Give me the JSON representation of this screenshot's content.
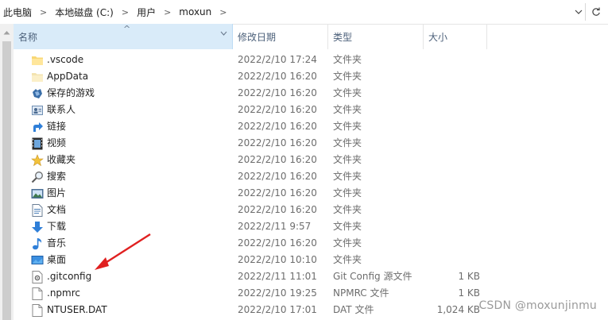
{
  "address": {
    "crumbs": [
      {
        "label": "此电脑"
      },
      {
        "label": "本地磁盘 (C:)"
      },
      {
        "label": "用户"
      },
      {
        "label": "moxun"
      }
    ],
    "icons": {
      "dropdown": "chevron-down-icon",
      "refresh": "refresh-icon",
      "separator": "chevron-right-icon"
    }
  },
  "columns": {
    "name": "名称",
    "date": "修改日期",
    "type": "类型",
    "size": "大小"
  },
  "files": [
    {
      "name": ".vscode",
      "date": "2022/2/10 17:24",
      "type": "文件夹",
      "size": "",
      "icon": "folder-icon"
    },
    {
      "name": "AppData",
      "date": "2022/2/10 16:20",
      "type": "文件夹",
      "size": "",
      "icon": "folder-light-icon"
    },
    {
      "name": "保存的游戏",
      "date": "2022/2/10 16:20",
      "type": "文件夹",
      "size": "",
      "icon": "saved-games-icon"
    },
    {
      "name": "联系人",
      "date": "2022/2/10 16:20",
      "type": "文件夹",
      "size": "",
      "icon": "contacts-icon"
    },
    {
      "name": "链接",
      "date": "2022/2/10 16:20",
      "type": "文件夹",
      "size": "",
      "icon": "links-icon"
    },
    {
      "name": "视频",
      "date": "2022/2/10 16:20",
      "type": "文件夹",
      "size": "",
      "icon": "videos-icon"
    },
    {
      "name": "收藏夹",
      "date": "2022/2/10 16:20",
      "type": "文件夹",
      "size": "",
      "icon": "favorites-star-icon"
    },
    {
      "name": "搜索",
      "date": "2022/2/10 16:20",
      "type": "文件夹",
      "size": "",
      "icon": "search-icon"
    },
    {
      "name": "图片",
      "date": "2022/2/10 16:20",
      "type": "文件夹",
      "size": "",
      "icon": "pictures-icon"
    },
    {
      "name": "文档",
      "date": "2022/2/10 16:20",
      "type": "文件夹",
      "size": "",
      "icon": "documents-icon"
    },
    {
      "name": "下载",
      "date": "2022/2/11 9:57",
      "type": "文件夹",
      "size": "",
      "icon": "downloads-icon"
    },
    {
      "name": "音乐",
      "date": "2022/2/10 16:20",
      "type": "文件夹",
      "size": "",
      "icon": "music-icon"
    },
    {
      "name": "桌面",
      "date": "2022/2/10 10:10",
      "type": "文件夹",
      "size": "",
      "icon": "desktop-icon"
    },
    {
      "name": ".gitconfig",
      "date": "2022/2/11 11:01",
      "type": "Git Config 源文件",
      "size": "1 KB",
      "icon": "config-file-icon"
    },
    {
      "name": ".npmrc",
      "date": "2022/2/10 19:25",
      "type": "NPMRC 文件",
      "size": "1 KB",
      "icon": "file-icon"
    },
    {
      "name": "NTUSER.DAT",
      "date": "2022/2/10 17:01",
      "type": "DAT 文件",
      "size": "1,024 KB",
      "icon": "file-icon"
    }
  ],
  "watermark": "CSDN @moxunjinmu",
  "annotation": {
    "color": "#e02020",
    "points_to": ".gitconfig"
  }
}
